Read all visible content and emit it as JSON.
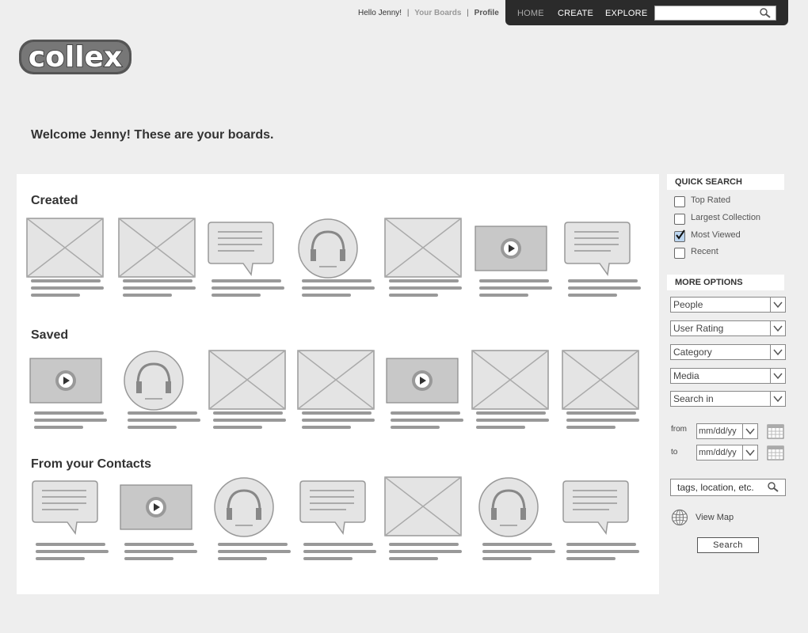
{
  "user_links": {
    "greeting": "Hello Jenny!",
    "sep1": "|",
    "your_boards": "Your Boards",
    "sep2": "|",
    "profile": "Profile"
  },
  "nav": {
    "home": "HOME",
    "create": "CREATE",
    "explore": "EXPLORE",
    "search_value": ""
  },
  "logo": {
    "text": "collex"
  },
  "welcome": "Welcome Jenny! These are your boards.",
  "sections": [
    {
      "title": "Created",
      "tiles": [
        "image",
        "image",
        "comment",
        "audio",
        "image",
        "video",
        "comment"
      ]
    },
    {
      "title": "Saved",
      "tiles": [
        "video",
        "audio",
        "image",
        "image",
        "video",
        "image",
        "image"
      ]
    },
    {
      "title": "From your Contacts",
      "tiles": [
        "comment",
        "video",
        "audio",
        "comment",
        "image",
        "audio",
        "comment"
      ]
    }
  ],
  "quick_search": {
    "heading": "QUICK SEARCH",
    "options": [
      {
        "label": "Top Rated",
        "checked": false
      },
      {
        "label": "Largest Collection",
        "checked": false
      },
      {
        "label": "Most Viewed",
        "checked": true
      },
      {
        "label": "Recent",
        "checked": false
      }
    ]
  },
  "more_options": {
    "heading": "MORE OPTIONS",
    "selects": [
      "People",
      "User Rating",
      "Category",
      "Media",
      "Search in"
    ],
    "from_label": "from",
    "to_label": "to",
    "from_value": "mm/dd/yy",
    "to_value": "mm/dd/yy",
    "tags_value": "tags, location, etc.",
    "view_map": "View Map",
    "search_button": "Search"
  },
  "icons": {
    "search": "magnifier-icon",
    "calendar": "calendar-icon",
    "globe": "globe-icon",
    "dropdown": "chevron-down-icon",
    "check": "checkmark-icon"
  }
}
